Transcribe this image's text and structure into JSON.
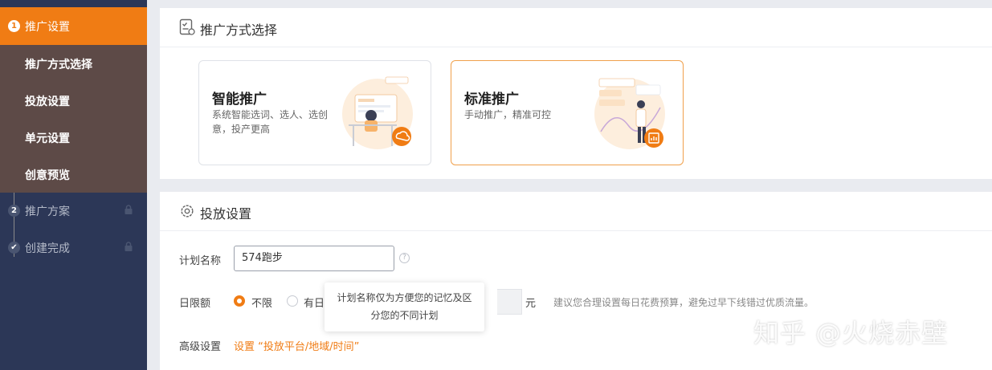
{
  "sidebar": {
    "active_step": {
      "num": "1",
      "label": "推广设置"
    },
    "sub_items": [
      {
        "label": "推广方式选择"
      },
      {
        "label": "投放设置"
      },
      {
        "label": "单元设置"
      },
      {
        "label": "创意预览"
      }
    ],
    "other_steps": [
      {
        "num": "2",
        "label": "推广方案",
        "locked": true
      },
      {
        "num": "check",
        "label": "创建完成",
        "locked": true
      }
    ],
    "colors": {
      "active": "#f07c14",
      "bg": "#2c3757",
      "sub_bg": "#5d4a47"
    }
  },
  "promo_method": {
    "title": "推广方式选择",
    "options": [
      {
        "title": "智能推广",
        "desc": "系统智能选词、选人、选创意，投产更高",
        "selected": false
      },
      {
        "title": "标准推广",
        "desc": "手动推广，精准可控",
        "selected": true
      }
    ]
  },
  "delivery": {
    "title": "投放设置",
    "plan_name": {
      "label": "计划名称",
      "value": "574跑步"
    },
    "daily_limit": {
      "label": "日限额",
      "options": [
        {
          "label": "不限",
          "checked": true
        },
        {
          "label": "有日",
          "checked": false
        }
      ],
      "unit": "元",
      "hint": "建议您合理设置每日花费预算，避免过早下线错过优质流量。"
    },
    "advanced": {
      "label": "高级设置",
      "link": "设置 “投放平台/地域/时间”"
    }
  },
  "tooltip": {
    "text": "计划名称仅为方便您的记忆及区分您的不同计划"
  },
  "watermark": "知乎 @火烧赤壁"
}
